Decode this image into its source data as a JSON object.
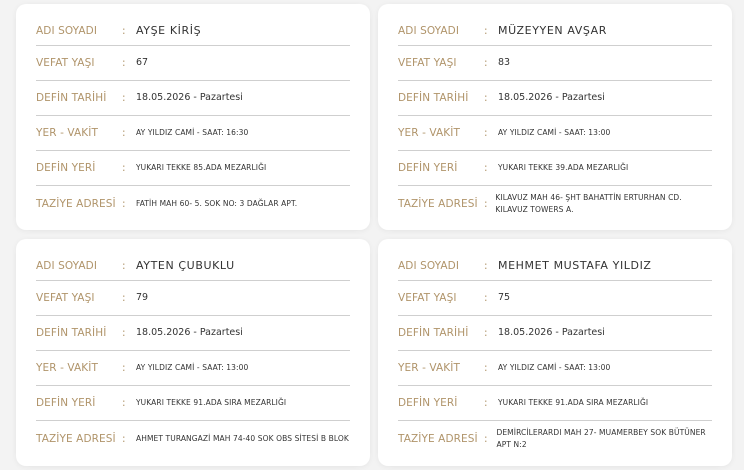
{
  "labels": {
    "name": "ADI SOYADI",
    "age": "VEFAT YAŞI",
    "burial_date": "DEFİN TARİHİ",
    "place_time": "YER - VAKİT",
    "burial_place": "DEFİN YERİ",
    "condolence_address": "TAZİYE ADRESİ",
    "colon": ":"
  },
  "cards": [
    {
      "name": "AYŞE KİRİŞ",
      "age": "67",
      "burial_date": "18.05.2026 - Pazartesi",
      "place_time": "AY YILDIZ CAMİ - SAAT: 16:30",
      "burial_place": "YUKARI TEKKE 85.ADA MEZARLIĞI",
      "condolence_address": "FATİH MAH 60- 5. SOK NO: 3 DAĞLAR APT."
    },
    {
      "name": "MÜZEYYEN AVŞAR",
      "age": "83",
      "burial_date": "18.05.2026 - Pazartesi",
      "place_time": "AY YILDIZ CAMİ - SAAT: 13:00",
      "burial_place": "YUKARI TEKKE 39.ADA MEZARLIĞI",
      "condolence_address": "KILAVUZ MAH 46- ŞHT BAHATTİN ERTURHAN CD. KILAVUZ TOWERS A."
    },
    {
      "name": "AYTEN ÇUBUKLU",
      "age": "79",
      "burial_date": "18.05.2026 - Pazartesi",
      "place_time": "AY YILDIZ CAMİ - SAAT: 13:00",
      "burial_place": "YUKARI TEKKE 91.ADA SIRA MEZARLIĞI",
      "condolence_address": "AHMET TURANGAZİ MAH 74-40 SOK OBS SİTESİ B BLOK"
    },
    {
      "name": "MEHMET MUSTAFA YILDIZ",
      "age": "75",
      "burial_date": "18.05.2026 - Pazartesi",
      "place_time": "AY YILDIZ CAMİ - SAAT: 13:00",
      "burial_place": "YUKARI TEKKE 91.ADA SIRA MEZARLIĞI",
      "condolence_address": "DEMİRCİLERARDI MAH 27- MUAMERBEY SOK BÜTÜNER APT N:2"
    }
  ],
  "colors": {
    "label": "#b0946a",
    "value": "#333333",
    "divider": "#cfcfcf",
    "card_bg": "#ffffff",
    "page_bg": "#f3f3f3"
  }
}
